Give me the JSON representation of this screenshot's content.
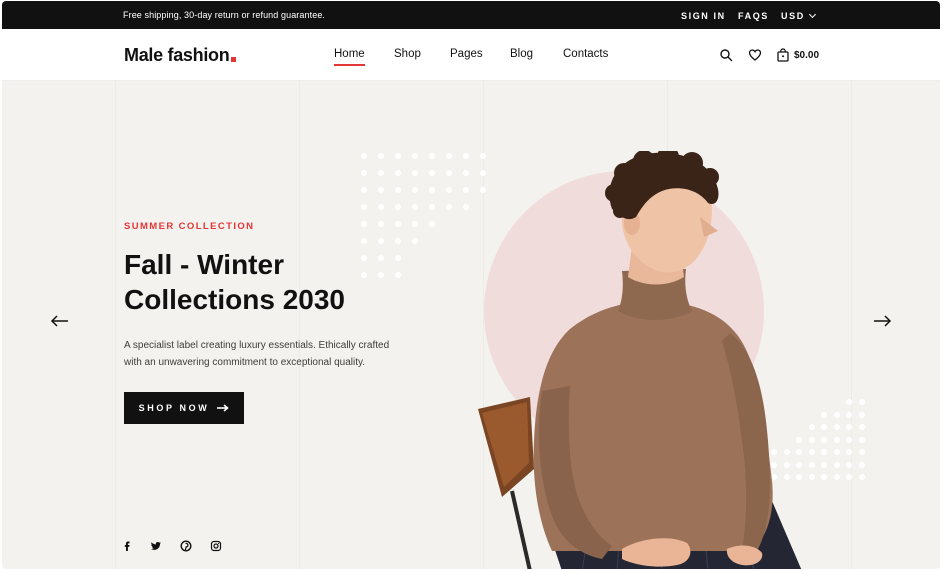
{
  "topbar": {
    "promo": "Free shipping, 30-day return or refund guarantee.",
    "sign_in": "SIGN IN",
    "faqs": "FAQS",
    "currency": "USD"
  },
  "header": {
    "logo": "Male fashion",
    "nav": [
      "Home",
      "Shop",
      "Pages",
      "Blog",
      "Contacts"
    ],
    "active_nav": "Home",
    "cart_total": "$0.00",
    "icons": [
      "search-icon",
      "heart-icon",
      "bag-icon"
    ]
  },
  "hero": {
    "eyebrow": "SUMMER COLLECTION",
    "headline_line1": "Fall - Winter",
    "headline_line2": "Collections 2030",
    "description": "A specialist label creating luxury essentials. Ethically crafted with an unwavering commitment to exceptional quality.",
    "cta": "SHOP NOW",
    "prev_icon": "arrow-left-icon",
    "next_icon": "arrow-right-icon",
    "social_icons": [
      "facebook-icon",
      "twitter-icon",
      "pinterest-icon",
      "instagram-icon"
    ]
  },
  "colors": {
    "accent": "#e53637",
    "dark": "#111111",
    "hero_bg": "#f3f2ee",
    "circle": "#f1dcdc",
    "sweater": "#9c7259"
  }
}
